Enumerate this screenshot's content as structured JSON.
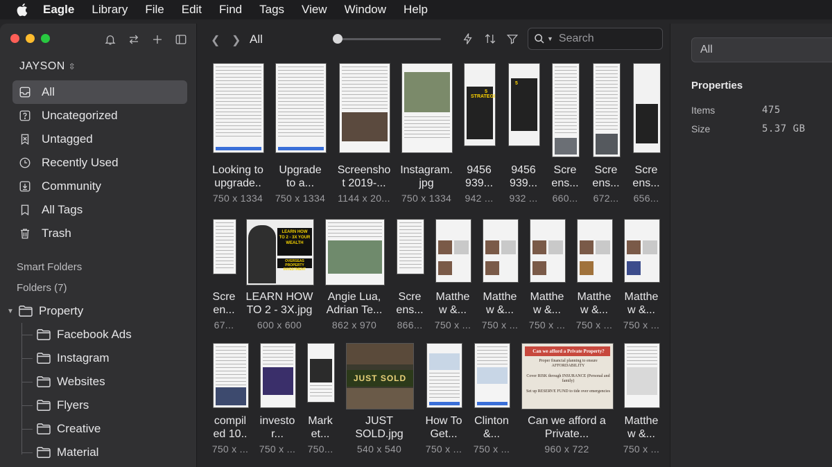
{
  "menubar": {
    "app": "Eagle",
    "items": [
      "Library",
      "File",
      "Edit",
      "Find",
      "Tags",
      "View",
      "Window",
      "Help"
    ]
  },
  "sidebar": {
    "library_name": "JAYSON",
    "nav": [
      {
        "label": "All",
        "icon": "all-inbox-icon",
        "active": true
      },
      {
        "label": "Uncategorized",
        "icon": "question-box-icon"
      },
      {
        "label": "Untagged",
        "icon": "untagged-icon"
      },
      {
        "label": "Recently Used",
        "icon": "clock-icon"
      },
      {
        "label": "Community",
        "icon": "download-box-icon"
      },
      {
        "label": "All Tags",
        "icon": "bookmark-icon"
      },
      {
        "label": "Trash",
        "icon": "trash-icon"
      }
    ],
    "smart_folders": "Smart Folders",
    "folders_label": "Folders (7)",
    "folders": [
      {
        "label": "Property",
        "expanded": true
      },
      {
        "label": "Facebook Ads"
      },
      {
        "label": "Instagram"
      },
      {
        "label": "Websites"
      },
      {
        "label": "Flyers"
      },
      {
        "label": "Creative"
      },
      {
        "label": "Material"
      }
    ]
  },
  "toolbar": {
    "title": "All",
    "search_placeholder": "Search"
  },
  "grid": {
    "rows": [
      [
        {
          "caption": "Looking to\nupgrade..",
          "dims": "750 x 1334",
          "kind": "doc"
        },
        {
          "caption": "Upgrade\nto a...",
          "dims": "750 x 1334",
          "kind": "doc"
        },
        {
          "caption": "Screensho\nt 2019-...",
          "dims": "1144 x 20...",
          "kind": "doc"
        },
        {
          "caption": "Instagram.\njpg",
          "dims": "750 x 1334",
          "kind": "doc"
        },
        {
          "caption": "9456\n939...",
          "dims": "942 ...",
          "kind": "promo"
        },
        {
          "caption": "9456\n939...",
          "dims": "932 ...",
          "kind": "promo"
        },
        {
          "caption": "Scre\nens...",
          "dims": "660...",
          "kind": "doc"
        },
        {
          "caption": "Scre\nens...",
          "dims": "672...",
          "kind": "doc"
        },
        {
          "caption": "Scre\nens...",
          "dims": "656...",
          "kind": "promo"
        }
      ],
      [
        {
          "caption": "Scre\nen...",
          "dims": "67...",
          "kind": "doc"
        },
        {
          "caption": "LEARN HOW\nTO 2 - 3X.jpg",
          "dims": "600 x 600",
          "kind": "dark"
        },
        {
          "caption": "Angie Lua,\nAdrian Te...",
          "dims": "862 x 970",
          "kind": "doc"
        },
        {
          "caption": "Scre\nens...",
          "dims": "866...",
          "kind": "doc"
        },
        {
          "caption": "Matthe\nw &...",
          "dims": "750 x ...",
          "kind": "listing"
        },
        {
          "caption": "Matthe\nw &...",
          "dims": "750 x ...",
          "kind": "listing"
        },
        {
          "caption": "Matthe\nw &...",
          "dims": "750 x ...",
          "kind": "listing"
        },
        {
          "caption": "Matthe\nw &...",
          "dims": "750 x ...",
          "kind": "listing"
        },
        {
          "caption": "Matthe\nw &...",
          "dims": "750 x ...",
          "kind": "listing"
        }
      ],
      [
        {
          "caption": "compil\ned 10..",
          "dims": "750 x ...",
          "kind": "doc"
        },
        {
          "caption": "investo\nr...",
          "dims": "750 x ...",
          "kind": "doc"
        },
        {
          "caption": "Mark\net...",
          "dims": "750...",
          "kind": "doc"
        },
        {
          "caption": "JUST\nSOLD.jpg",
          "dims": "540 x 540",
          "kind": "green"
        },
        {
          "caption": "How To\nGet...",
          "dims": "750 x ...",
          "kind": "doc"
        },
        {
          "caption": "Clinton\n&...",
          "dims": "750 x ...",
          "kind": "doc"
        },
        {
          "caption": "Can we afford a\nPrivate...",
          "dims": "960 x 722",
          "kind": "affordable"
        },
        {
          "caption": "Matthe\nw &...",
          "dims": "750 x ...",
          "kind": "doc"
        }
      ]
    ],
    "thumb_texts": {
      "learn": "LEARN HOW TO 2 - 3X YOUR WEALTH",
      "learn_sub": "OVERSEAS PROPERTY INVESTMENT",
      "just_sold": "JUST SOLD",
      "afford_title": "Can we afford a Private Property?",
      "afford_1": "Proper financial planning to ensure AFFORDABILITY",
      "afford_2": "Cover RISK through INSURANCE (Personal and family)",
      "afford_3": "Set up RESERVE FUND to tide over emergencies",
      "promo": "5 STRATEGIES"
    }
  },
  "inspector": {
    "field": "All",
    "heading": "Properties",
    "items_label": "Items",
    "items_value": "475",
    "size_label": "Size",
    "size_value": "5.37 GB"
  }
}
